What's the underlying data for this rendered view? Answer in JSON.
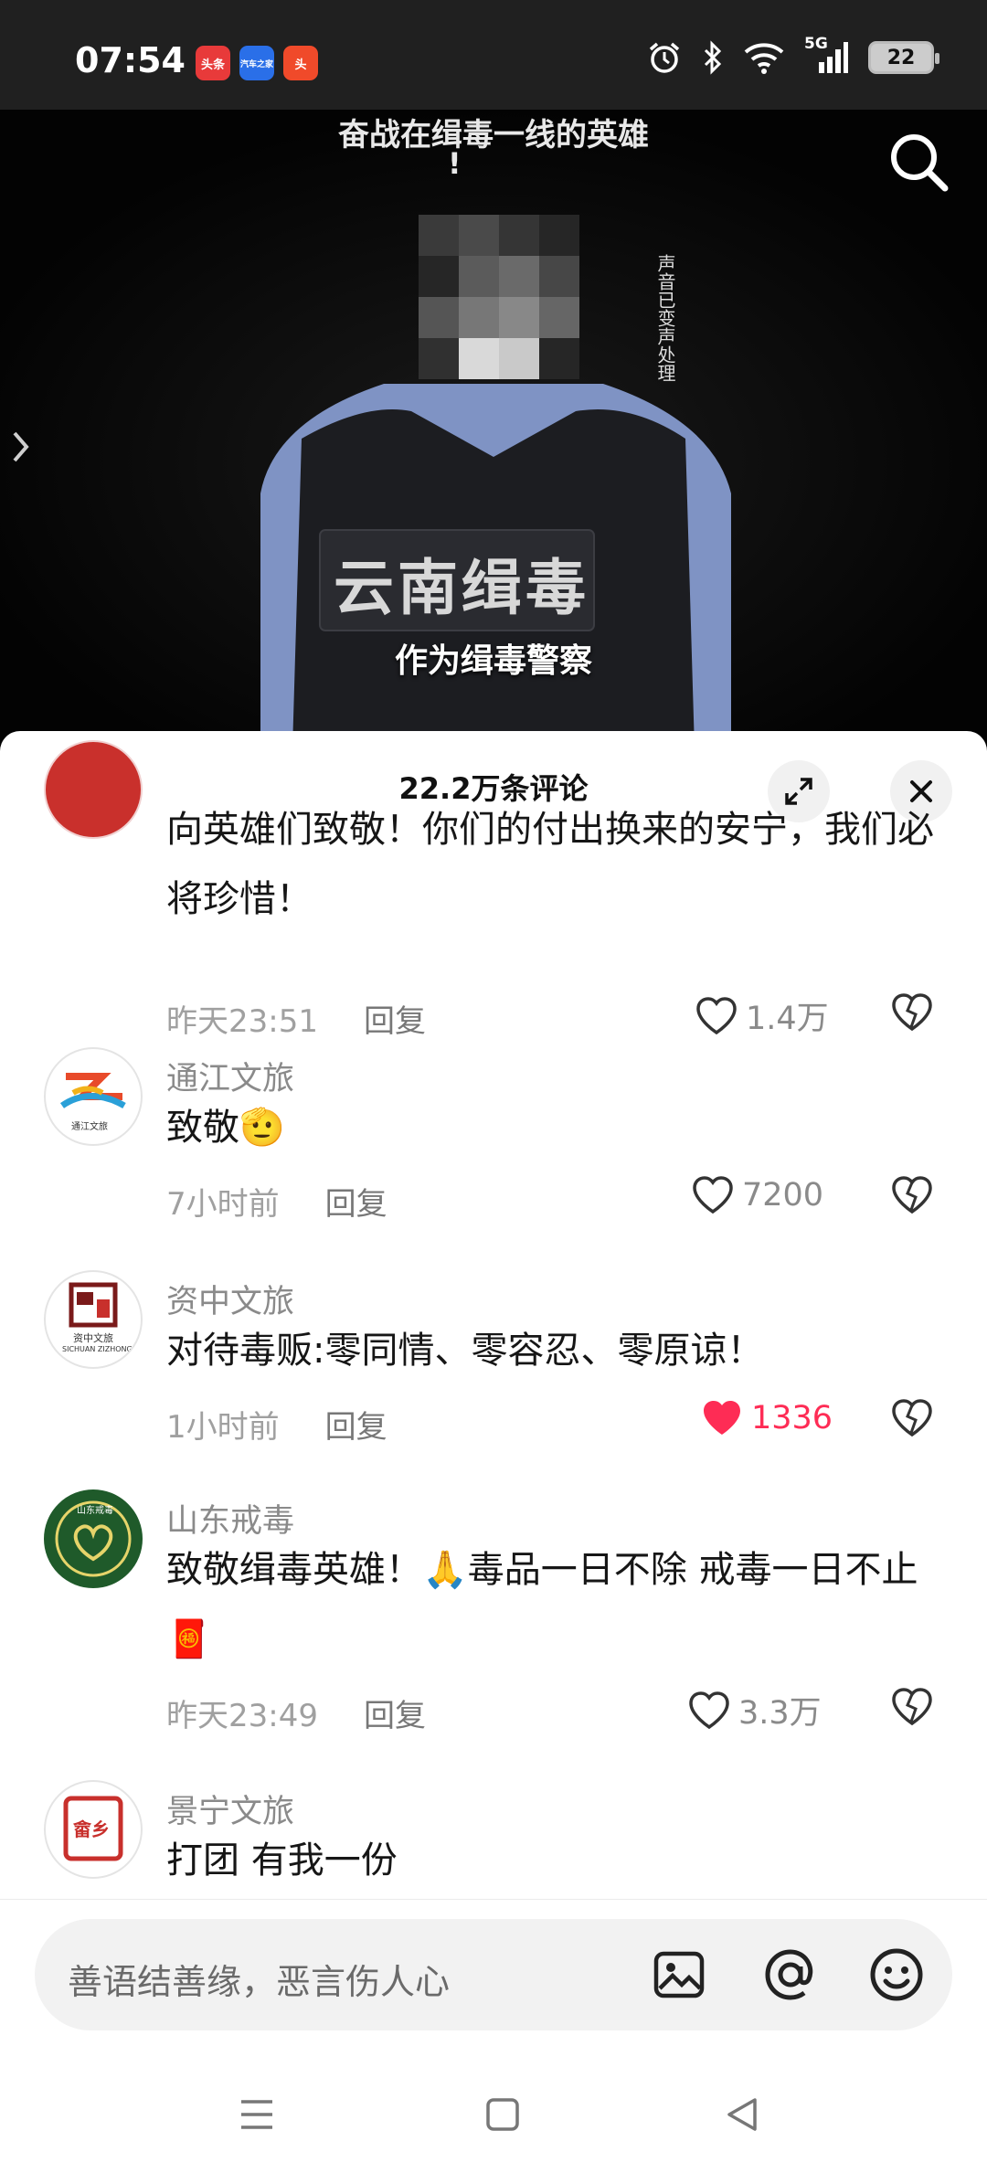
{
  "status_bar": {
    "time": "07:54",
    "app_badges": [
      {
        "label": "头条",
        "color": "#e83a3a"
      },
      {
        "label": "汽车之家",
        "color": "#2a6fe8"
      },
      {
        "label": "头",
        "color": "#f04a2a"
      }
    ],
    "network": "5G",
    "battery": "22"
  },
  "video": {
    "caption_top": "奋战在缉毒一线的英雄",
    "caption_top_2": "!",
    "vest_text": "云南缉毒",
    "vertical_note": "声音已变声处理",
    "subtitle": "作为缉毒警察"
  },
  "comments_panel": {
    "title": "22.2万条评论",
    "comments": [
      {
        "user": "",
        "text": "向英雄们致敬！你们的付出换来的安宁，我们必将珍惜！",
        "time": "昨天23:51",
        "reply": "回复",
        "likes": "1.4万",
        "liked": false
      },
      {
        "user": "通江文旅",
        "text": "致敬🫡",
        "time": "7小时前",
        "reply": "回复",
        "likes": "7200",
        "liked": false
      },
      {
        "user": "资中文旅",
        "text": "对待毒贩:零同情、零容忍、零原谅！",
        "time": "1小时前",
        "reply": "回复",
        "likes": "1336",
        "liked": true
      },
      {
        "user": "山东戒毒",
        "text": "致敬缉毒英雄！🙏毒品一日不除 戒毒一日不止🧧",
        "time": "昨天23:49",
        "reply": "回复",
        "likes": "3.3万",
        "liked": false
      },
      {
        "user": "景宁文旅",
        "text": "打团 有我一份",
        "time": "",
        "reply": "",
        "likes": "",
        "liked": false
      }
    ],
    "avatar_texts": {
      "tongjiang": "通江文旅",
      "zizhong": "资中文旅",
      "zizhong_en": "SICHUAN ZIZHONG",
      "shandong": "山东戒毒",
      "jingning": "畲乡"
    }
  },
  "input": {
    "placeholder": "善语结善缘，恶言伤人心"
  },
  "colors": {
    "like_active": "#fe2c55",
    "text_primary": "#161616",
    "text_secondary": "#8a8a8a"
  },
  "icons": [
    "search-icon",
    "expand-icon",
    "close-icon",
    "heart-icon",
    "broken-heart-icon",
    "image-icon",
    "at-icon",
    "emoji-icon",
    "menu-icon",
    "home-icon",
    "back-icon"
  ]
}
